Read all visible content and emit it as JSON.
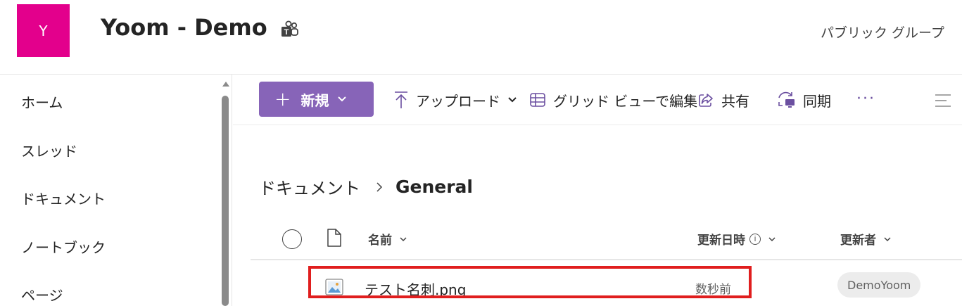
{
  "header": {
    "avatar_letter": "Y",
    "site_title": "Yoom - Demo",
    "group_type": "パブリック グループ",
    "colors": {
      "avatar_bg": "#e3008c"
    }
  },
  "sidebar": {
    "items": [
      {
        "label": "ホーム"
      },
      {
        "label": "スレッド"
      },
      {
        "label": "ドキュメント"
      },
      {
        "label": "ノートブック"
      },
      {
        "label": "ページ"
      }
    ]
  },
  "toolbar": {
    "new_label": "新規",
    "upload_label": "アップロード",
    "grid_edit_label": "グリッド ビューで編集",
    "share_label": "共有",
    "sync_label": "同期",
    "more_label": "···",
    "colors": {
      "accent": "#8764b8"
    }
  },
  "breadcrumb": {
    "root": "ドキュメント",
    "current": "General"
  },
  "table": {
    "columns": {
      "name": "名前",
      "modified": "更新日時",
      "modified_by": "更新者"
    },
    "rows": [
      {
        "name": "テスト名刺.png",
        "modified": "数秒前",
        "modified_by": "DemoYoom"
      }
    ]
  }
}
